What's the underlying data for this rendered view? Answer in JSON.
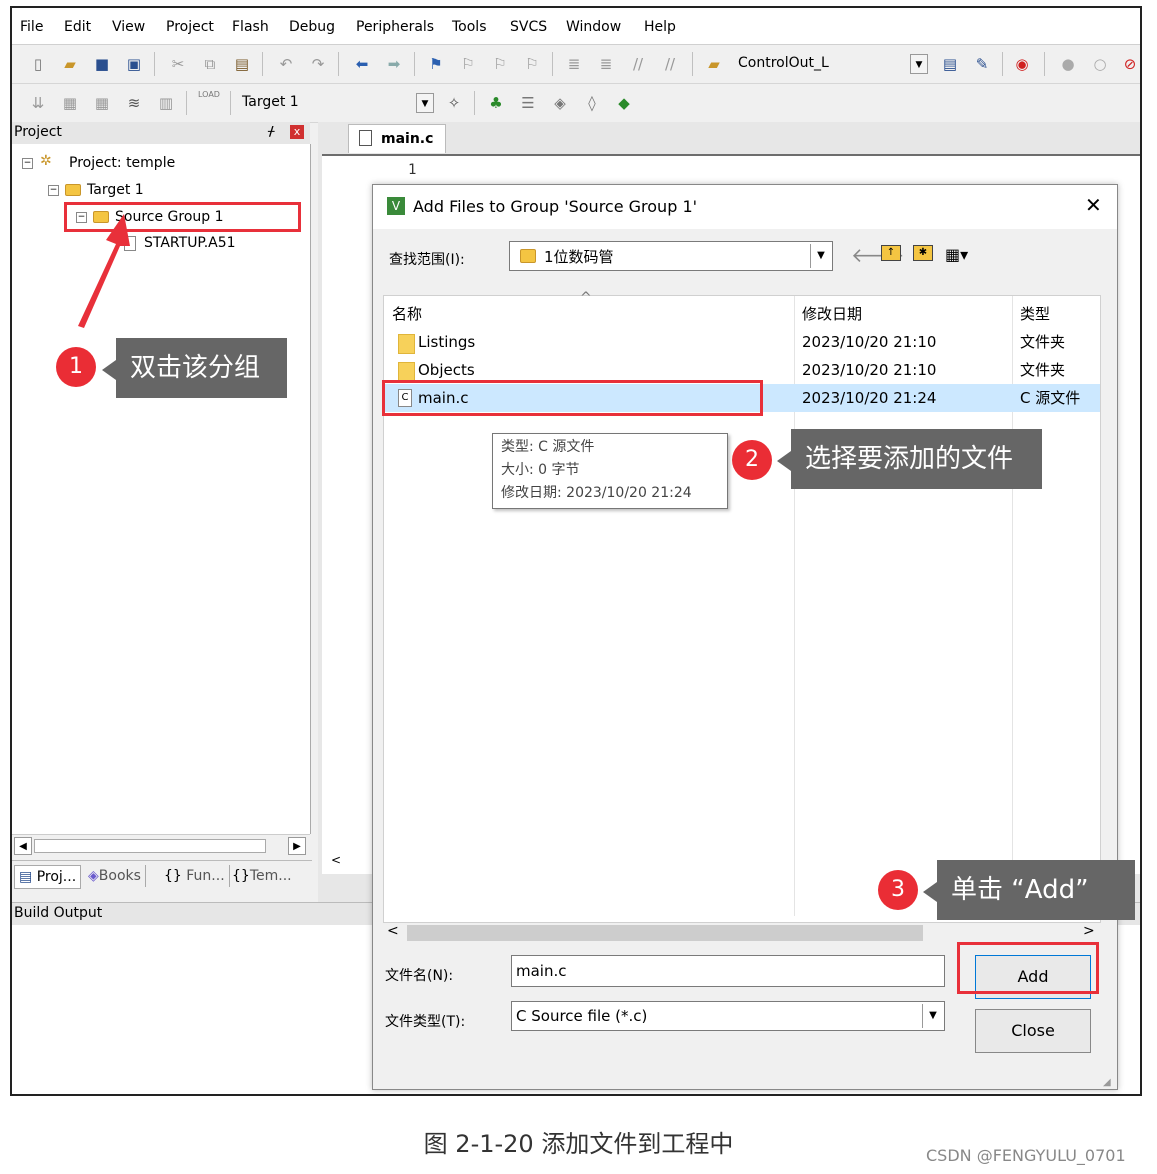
{
  "menubar": {
    "items": [
      "File",
      "Edit",
      "View",
      "Project",
      "Flash",
      "Debug",
      "Peripherals",
      "Tools",
      "SVCS",
      "Window",
      "Help"
    ]
  },
  "toolbar1": {
    "target_combo": "ControlOut_L"
  },
  "toolbar2": {
    "load_label": "LOAD",
    "target_select": "Target 1"
  },
  "project_pane": {
    "title": "Project",
    "pin": "ᚋ",
    "close": "x",
    "tree": {
      "project": "Project: temple",
      "target": "Target 1",
      "group": "Source Group 1",
      "file": "STARTUP.A51"
    },
    "tabs": [
      "Proj...",
      "Books",
      "Fun...",
      "Tem..."
    ]
  },
  "editor": {
    "tab_label": "main.c",
    "line_number": "1"
  },
  "build_output": {
    "title": "Build Output"
  },
  "dialog": {
    "title": "Add Files to Group 'Source Group 1'",
    "close_glyph": "✕",
    "lookin_label": "查找范围(I):",
    "lookin_value": "1位数码管",
    "columns": [
      "名称",
      "修改日期",
      "类型"
    ],
    "files": [
      {
        "name": "Listings",
        "date": "2023/10/20 21:10",
        "type": "文件夹"
      },
      {
        "name": "Objects",
        "date": "2023/10/20 21:10",
        "type": "文件夹"
      },
      {
        "name": "main.c",
        "date": "2023/10/20 21:24",
        "type": "C 源文件"
      }
    ],
    "tooltip": {
      "type": "类型: C 源文件",
      "size": "大小: 0 字节",
      "date": "修改日期: 2023/10/20 21:24"
    },
    "filename_label": "文件名(N):",
    "filename_value": "main.c",
    "filetype_label": "文件类型(T):",
    "filetype_value": "C Source file (*.c)",
    "add_button": "Add",
    "close_button": "Close"
  },
  "annotations": {
    "step1": {
      "num": "1",
      "text": "双击该分组"
    },
    "step2": {
      "num": "2",
      "text": "选择要添加的文件"
    },
    "step3": {
      "num": "3",
      "text": "单击 “Add”"
    },
    "color": "#e8303a"
  },
  "caption": "图 2-1-20 添加文件到工程中",
  "watermark": "CSDN @FENGYULU_0701"
}
